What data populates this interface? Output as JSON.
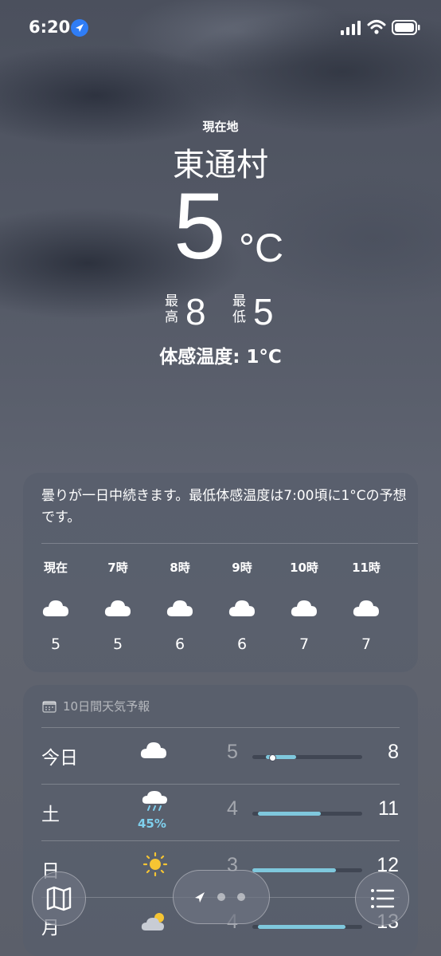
{
  "status": {
    "time": "6:20"
  },
  "hero": {
    "location_label": "現在地",
    "city": "東通村",
    "temp": "5",
    "unit": "°C",
    "high_label": "最高",
    "high": "8",
    "low_label": "最低",
    "low": "5",
    "feels_like": "体感温度: 1°C"
  },
  "hourly": {
    "summary": "曇りが一日中続きます。最低体感温度は7:00頃に1°Cの予想です。",
    "hours": [
      {
        "label": "現在",
        "icon": "cloud-icon",
        "temp": "5"
      },
      {
        "label": "7時",
        "icon": "cloud-icon",
        "temp": "5"
      },
      {
        "label": "8時",
        "icon": "cloud-icon",
        "temp": "6"
      },
      {
        "label": "9時",
        "icon": "cloud-icon",
        "temp": "6"
      },
      {
        "label": "10時",
        "icon": "cloud-icon",
        "temp": "7"
      },
      {
        "label": "11時",
        "icon": "cloud-icon",
        "temp": "7"
      }
    ]
  },
  "daily": {
    "title": "10日間天気予報",
    "rows": [
      {
        "day": "今日",
        "icon": "cloud-icon",
        "pop": "",
        "low": "5",
        "high": "8",
        "bar_start": 0.12,
        "bar_end": 0.4
      },
      {
        "day": "土",
        "icon": "rain-cloud-icon",
        "pop": "45%",
        "low": "4",
        "high": "11",
        "bar_start": 0.05,
        "bar_end": 0.62
      },
      {
        "day": "日",
        "icon": "sun-icon",
        "pop": "",
        "low": "3",
        "high": "12",
        "bar_start": 0.0,
        "bar_end": 0.76
      },
      {
        "day": "月",
        "icon": "partly-cloudy-icon",
        "pop": "",
        "low": "4",
        "high": "13",
        "bar_start": 0.05,
        "bar_end": 0.85
      }
    ]
  },
  "colors": {
    "accent": "#2f7df6",
    "temp_bar": "#7fc8dd",
    "rain": "#7fd0ee"
  }
}
